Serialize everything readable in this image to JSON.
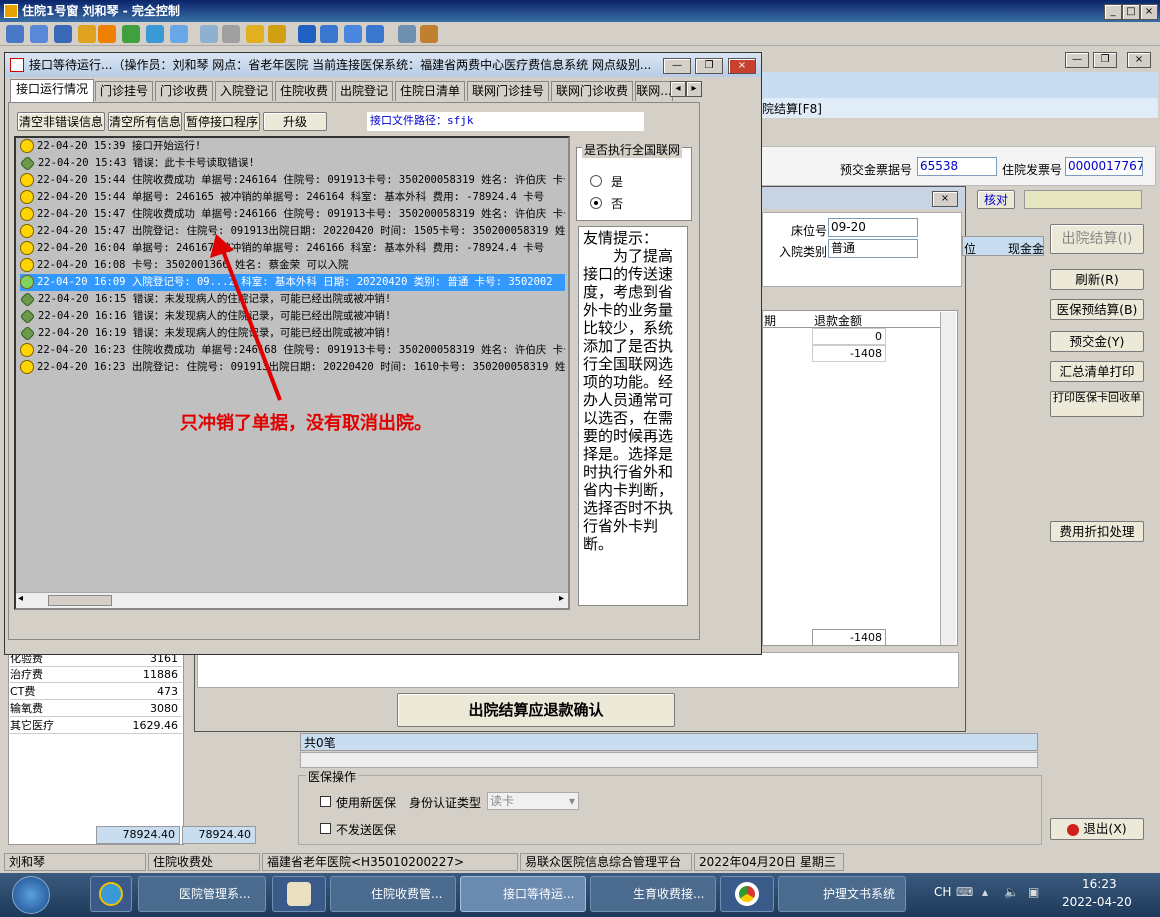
{
  "main_title": "住院1号窗  刘和琴  - 完全控制",
  "bg": {
    "nav_label": "院结算[F8]",
    "deposit_no_label": "预交金票据号",
    "deposit_no": "65538",
    "invoice_label": "住院发票号",
    "invoice_no": "0000017767",
    "verify_btn": "核对",
    "discharge_btn": "出院结算(I)",
    "buttons": [
      "刷新(R)",
      "医保预结算(B)",
      "预交金(Y)",
      "汇总清单打印",
      "打印医保卡回收单",
      "费用折扣处理"
    ],
    "exit_btn": "退出(X)",
    "total_label": "共0笔",
    "insurance_group": "医保操作",
    "use_new_insurance": "使用新医保",
    "id_type_label": "身份认证类型",
    "id_type_value": "读卡",
    "no_send_insurance": "不发送医保",
    "cost_rows": [
      {
        "name": "化验费",
        "amount": "3161"
      },
      {
        "name": "治疗费",
        "amount": "11886"
      },
      {
        "name": "CT费",
        "amount": "473"
      },
      {
        "name": "输氧费",
        "amount": "3080"
      },
      {
        "name": "其它医疗",
        "amount": "1629.46"
      }
    ],
    "total1": "78924.40",
    "total2": "78924.40",
    "status": [
      "刘和琴",
      "住院收费处",
      "福建省老年医院<H35010200227>",
      "易联众医院信息综合管理平台",
      "2022年04月20日 星期三"
    ]
  },
  "dialog2": {
    "bed_label": "床位号",
    "bed_value": "09-20",
    "adm_type_label": "入院类别",
    "adm_type_value": "普通",
    "col_date": "期",
    "col_refund": "退款金额",
    "rows": [
      {
        "refund": "0"
      },
      {
        "refund": "-1408"
      }
    ],
    "footer_refund": "-1408",
    "confirm_btn": "出院结算应退款确认",
    "header_col1": "位",
    "header_col2": "现金金"
  },
  "iface": {
    "title": "接口等待运行...（操作员：刘和琴 网点：省老年医院  当前连接医保系统：福建省两费中心医疗费信息系统 网点级别...",
    "tabs": [
      "接口运行情况",
      "门诊挂号",
      "门诊收费",
      "入院登记",
      "住院收费",
      "出院登记",
      "住院日清单",
      "联网门诊挂号",
      "联网门诊收费",
      "联网..."
    ],
    "btns": [
      "清空非错误信息",
      "清空所有信息",
      "暂停接口程序",
      "升级"
    ],
    "path_label": "接口文件路径：sfjk",
    "logs": [
      {
        "t": "ok",
        "text": "22-04-20 15:39 接口开始运行!"
      },
      {
        "t": "err",
        "text": "22-04-20 15:43 错误：此卡卡号读取错误!"
      },
      {
        "t": "ok",
        "text": "22-04-20 15:44 住院收费成功 单据号:246164 住院号: 091913卡号: 350200058319 姓名: 许伯庆 卡号"
      },
      {
        "t": "ok",
        "text": "22-04-20 15:44  单据号: 246165 被冲销的单据号: 246164 科室: 基本外科 费用: -78924.4 卡号"
      },
      {
        "t": "ok",
        "text": "22-04-20 15:47 住院收费成功 单据号:246166 住院号: 091913卡号: 350200058319 姓名: 许伯庆 卡号"
      },
      {
        "t": "ok",
        "text": "22-04-20 15:47 出院登记: 住院号: 091913出院日期: 20220420 时间: 1505卡号: 350200058319 姓"
      },
      {
        "t": "ok",
        "text": "22-04-20 16:04  单据号: 246167 被冲销的单据号: 246166 科室: 基本外科 费用: -78924.4 卡号"
      },
      {
        "t": "ok",
        "text": "22-04-20 16:08 卡号: 3502001366 姓名: 蔡金荣    可以入院"
      },
      {
        "t": "sel",
        "text": "22-04-20 16:09  入院登记号: 09...2 科室: 基本外科 日期: 20220420 类别: 普通 卡号: 3502002"
      },
      {
        "t": "err",
        "text": "22-04-20 16:15 错误：未发现病人的住院记录，可能已经出院或被冲销!"
      },
      {
        "t": "err",
        "text": "22-04-20 16:16 错误：未发现病人的住院记录，可能已经出院或被冲销!"
      },
      {
        "t": "err",
        "text": "22-04-20 16:19 错误：未发现病人的住院记录，可能已经出院或被冲销!"
      },
      {
        "t": "ok",
        "text": "22-04-20 16:23 住院收费成功 单据号:246168 住院号: 091913卡号: 350200058319 姓名: 许伯庆 卡号"
      },
      {
        "t": "ok",
        "text": "22-04-20 16:23 出院登记: 住院号: 091913出院日期: 20220420 时间: 1610卡号: 350200058319 姓"
      }
    ],
    "nation_group": "是否执行全国联网",
    "opt_yes": "是",
    "opt_no": "否",
    "tip_title": "友情提示：",
    "tip_body": "为了提高接口的传送速度，考虑到省外卡的业务量比较少，系统添加了是否执行全国联网选项的功能。经办人员通常可以选否，在需要的时候再选择是。选择是时执行省外和省内卡判断，选择否时不执行省外卡判断。"
  },
  "annotation": "只冲销了单据，没有取消出院。",
  "annotation_color": "#e00000",
  "taskbar": {
    "items": [
      "医院管理系...",
      "住院收费管...",
      "接口等待运...",
      "生育收费接...",
      "护理文书系统"
    ],
    "lang": "CH",
    "time": "16:23",
    "date": "2022-04-20"
  }
}
